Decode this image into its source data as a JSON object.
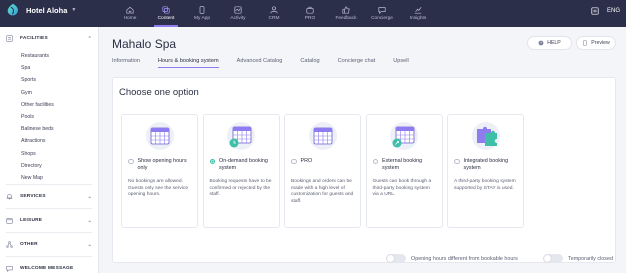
{
  "brand": {
    "name": "Hotel Aloha",
    "logo_icon": "aloha-logo-icon"
  },
  "nav": [
    {
      "label": "Home",
      "icon": "home-icon",
      "active": false
    },
    {
      "label": "Content",
      "icon": "content-icon",
      "active": true
    },
    {
      "label": "My App",
      "icon": "phone-icon",
      "active": false
    },
    {
      "label": "Activity",
      "icon": "activity-icon",
      "active": false
    },
    {
      "label": "CRM",
      "icon": "users-icon",
      "active": false
    },
    {
      "label": "PRO",
      "icon": "briefcase-icon",
      "active": false
    },
    {
      "label": "Feedback",
      "icon": "thumb-icon",
      "active": false
    },
    {
      "label": "Concierge",
      "icon": "chat-icon",
      "active": false
    },
    {
      "label": "Insights",
      "icon": "chart-icon",
      "active": false
    }
  ],
  "top_right": {
    "language": "ENG",
    "icon": "menu-icon"
  },
  "sidebar": {
    "facilities_label": "FACILITIES",
    "facilities_items": [
      "Restaurants",
      "Spa",
      "Sports",
      "Gym",
      "Other facilities",
      "Pools",
      "Balinese beds",
      "Attractions",
      "Shops",
      "Directory",
      "New Map"
    ],
    "services_label": "SERVICES",
    "leisure_label": "LEISURE",
    "other_label": "OTHER",
    "welcome_label": "WELCOME MESSAGE"
  },
  "page": {
    "title": "Mahalo Spa",
    "help_label": "HELP",
    "preview_label": "Preview"
  },
  "tabs": [
    {
      "label": "Information",
      "active": false
    },
    {
      "label": "Hours & booking system",
      "active": true
    },
    {
      "label": "Advanced Catalog",
      "active": false
    },
    {
      "label": "Catalog",
      "active": false
    },
    {
      "label": "Concierge chat",
      "active": false
    },
    {
      "label": "Upsell",
      "active": false
    }
  ],
  "card": {
    "title": "Choose one option",
    "options": [
      {
        "label": "Show opening hours only",
        "desc": "No bookings are allowed. Guests only see the service opening hours.",
        "checked": false,
        "art": "calendar-icon"
      },
      {
        "label": "On-demand booking system",
        "desc": "Booking requests have to be confirmed or rejected by the staff.",
        "checked": true,
        "art": "calendar-clock-icon"
      },
      {
        "label": "PRO",
        "desc": "Bookings and orders can be made with a high level of customization for guests and staff.",
        "checked": false,
        "art": "calendar-icon"
      },
      {
        "label": "External booking system",
        "desc": "Guests can book through a third-party booking system via a URL.",
        "checked": false,
        "art": "calendar-link-icon"
      },
      {
        "label": "Integrated booking system",
        "desc": "A third-party booking system supported by STAY is used.",
        "checked": false,
        "art": "puzzle-icon"
      }
    ]
  },
  "toggles": {
    "opening_hours_label": "Opening hours different from bookable hours",
    "temporarily_closed_label": "Temporarily closed"
  },
  "colors": {
    "topbar": "#2c2f4a",
    "accent": "#8f7cf0",
    "selected": "#3fbfa8"
  }
}
